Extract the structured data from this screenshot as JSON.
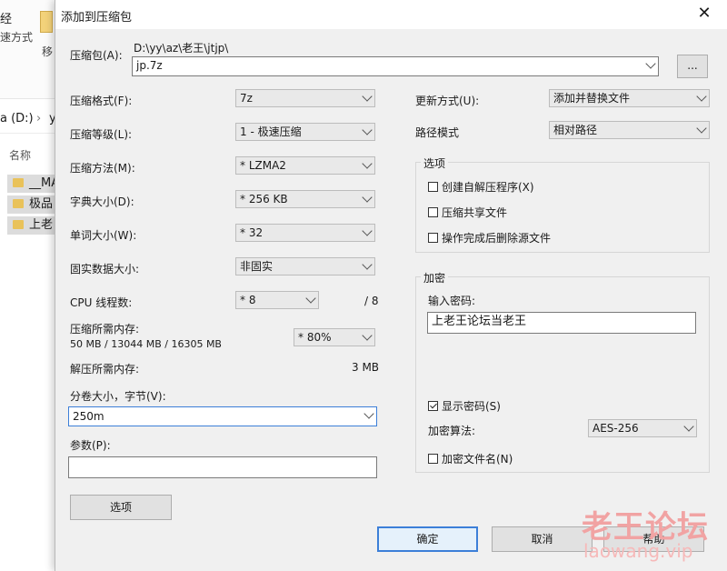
{
  "explorer": {
    "ribbon_text_1": "经",
    "ribbon_text_2": "速方式",
    "ribbon_text_3": "移",
    "address_drive": "a (D:)",
    "address_tail": "y",
    "column_name": "名称",
    "files": [
      "__MA",
      "极品",
      "上老"
    ]
  },
  "dialog": {
    "title": "添加到压缩包",
    "close": "✕",
    "archive": {
      "label": "压缩包(A):",
      "path": "D:\\yy\\az\\老王\\jtjp\\",
      "name": "jp.7z",
      "browse": "..."
    },
    "left": {
      "format_label": "压缩格式(F):",
      "format_value": "7z",
      "level_label": "压缩等级(L):",
      "level_value": "1 - 极速压缩",
      "method_label": "压缩方法(M):",
      "method_value": "* LZMA2",
      "dict_label": "字典大小(D):",
      "dict_value": "* 256 KB",
      "word_label": "单词大小(W):",
      "word_value": "* 32",
      "solid_label": "固实数据大小:",
      "solid_value": "非固实",
      "cpu_label": "CPU 线程数:",
      "cpu_value": "* 8",
      "cpu_total": "/ 8",
      "mem_comp_label": "压缩所需内存:",
      "mem_comp_detail": "50 MB / 13044 MB / 16305 MB",
      "mem_percent": "* 80%",
      "mem_decomp_label": "解压所需内存:",
      "mem_decomp_value": "3 MB",
      "volume_label": "分卷大小，字节(V):",
      "volume_value": "250m",
      "params_label": "参数(P):",
      "params_value": "",
      "options_button": "选项"
    },
    "right": {
      "update_label": "更新方式(U):",
      "update_value": "添加并替换文件",
      "path_label": "路径模式",
      "path_value": "相对路径",
      "options_group": "选项",
      "opt_sfx": "创建自解压程序(X)",
      "opt_shared": "压缩共享文件",
      "opt_delete": "操作完成后删除源文件",
      "encrypt_group": "加密",
      "password_label": "输入密码:",
      "password_value": "上老王论坛当老王",
      "show_password": "显示密码(S)",
      "algo_label": "加密算法:",
      "algo_value": "AES-256",
      "encrypt_names": "加密文件名(N)"
    },
    "buttons": {
      "ok": "确定",
      "cancel": "取消",
      "help": "帮助"
    }
  },
  "watermark": {
    "line1": "老王论坛",
    "line2": "laowang.vip"
  }
}
